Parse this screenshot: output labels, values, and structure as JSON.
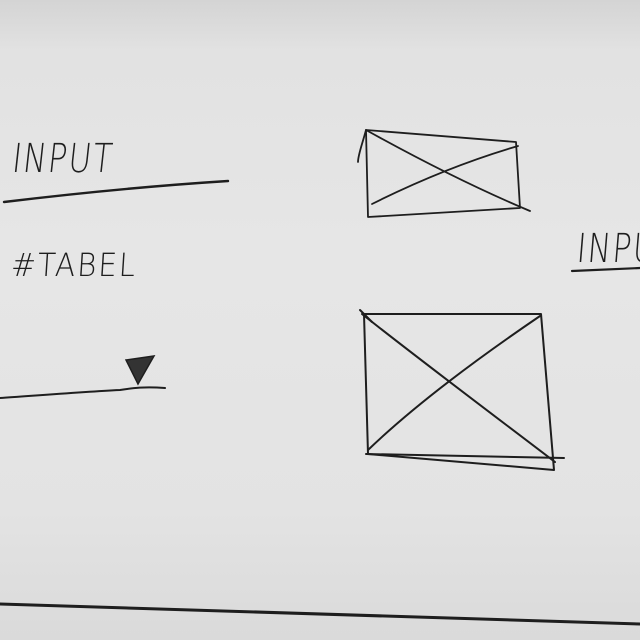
{
  "sketch": {
    "input_label_left": "INPUT",
    "table_label": "#TABEL",
    "input_label_right": "INPU",
    "image_placeholder_top": "image-placeholder",
    "image_placeholder_bottom": "image-placeholder",
    "slider_icon": "triangle-thumb-icon"
  },
  "colors": {
    "ink": "#1e1e1e",
    "paper": "#e4e4e4"
  }
}
